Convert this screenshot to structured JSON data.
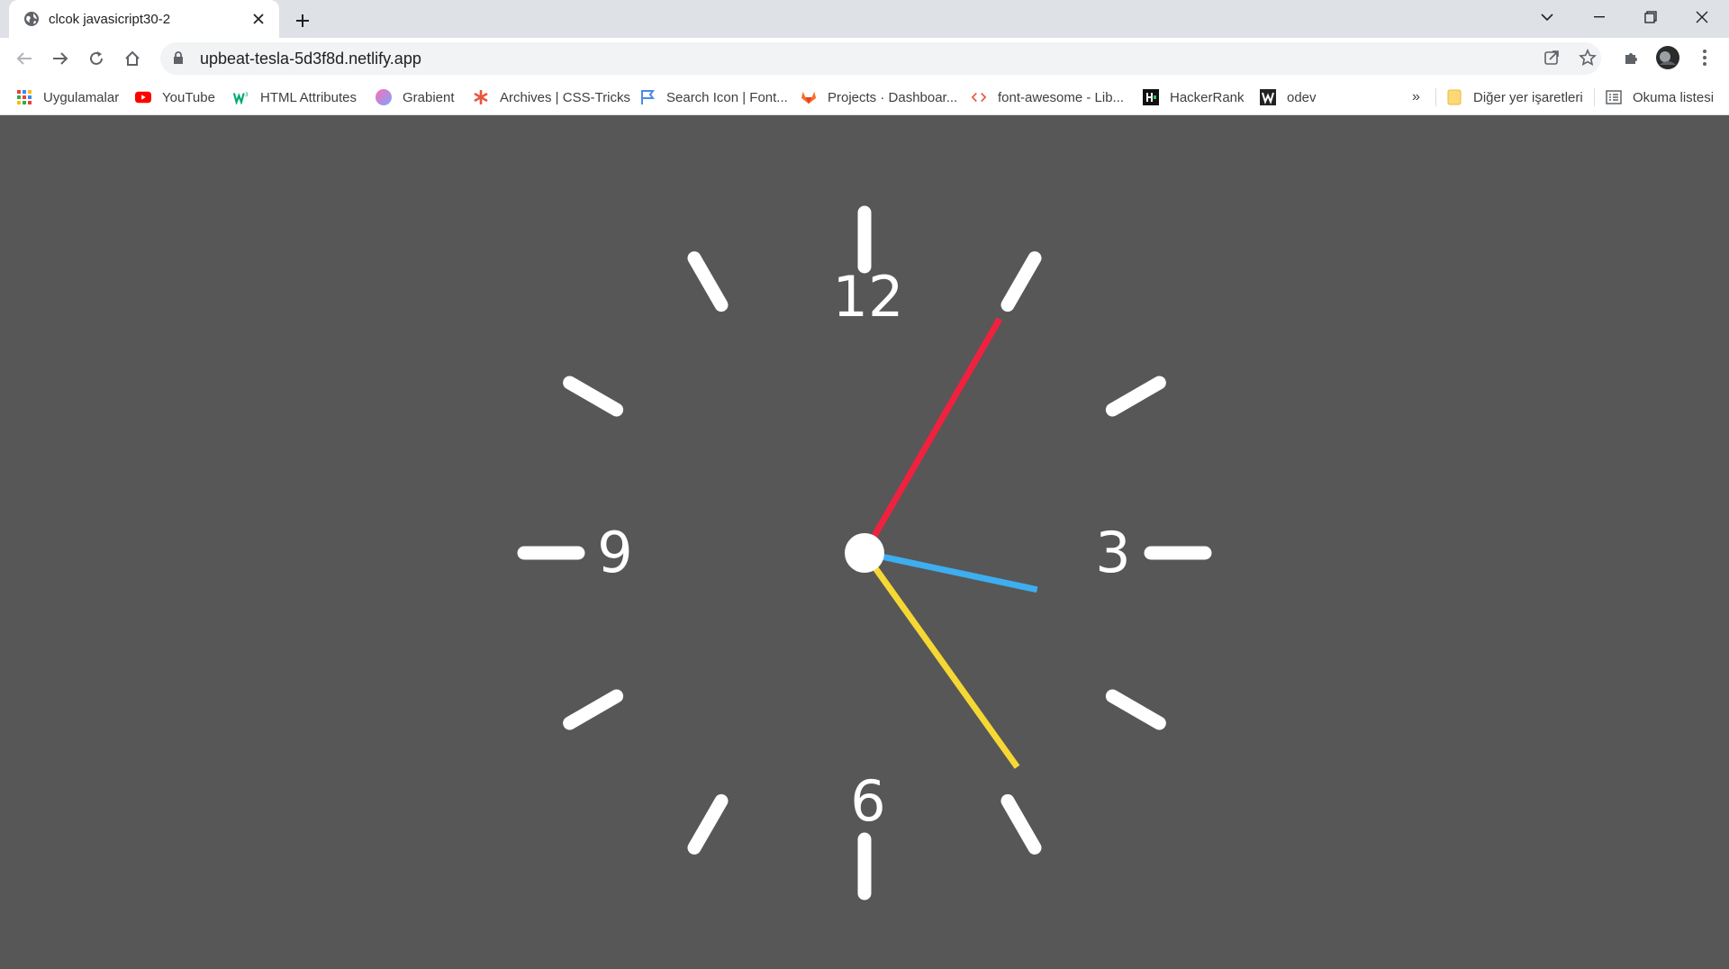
{
  "browser": {
    "tab": {
      "title": "clcok javasicript30-2"
    },
    "address": {
      "url": "upbeat-tesla-5d3f8d.netlify.app"
    },
    "bookmarks": [
      {
        "label": "Uygulamalar",
        "icon": "apps-grid-icon"
      },
      {
        "label": "YouTube",
        "icon": "youtube-icon"
      },
      {
        "label": "HTML Attributes",
        "icon": "w3schools-icon"
      },
      {
        "label": "Grabient",
        "icon": "grabient-icon"
      },
      {
        "label": "Archives | CSS-Tricks",
        "icon": "css-tricks-icon"
      },
      {
        "label": "Search Icon | Font...",
        "icon": "flag-icon"
      },
      {
        "label": "Projects · Dashboar...",
        "icon": "gitlab-icon"
      },
      {
        "label": "font-awesome - Lib...",
        "icon": "code-icon"
      },
      {
        "label": "HackerRank",
        "icon": "hackerrank-icon"
      },
      {
        "label": "odev",
        "icon": "w-icon"
      }
    ],
    "overflow_label": "»",
    "other_bookmarks": "Diğer yer işaretleri",
    "reading_list": "Okuma listesi"
  },
  "clock": {
    "numbers": {
      "twelve": "12",
      "three": "3",
      "six": "6",
      "nine": "9"
    },
    "time": {
      "hours": 3,
      "minutes": 24,
      "seconds": 5
    },
    "colors": {
      "hour_hand": "#3daef0",
      "minute_hand": "#f5d833",
      "second_hand": "#f0213f",
      "marks": "#ffffff",
      "background": "#575757"
    }
  }
}
